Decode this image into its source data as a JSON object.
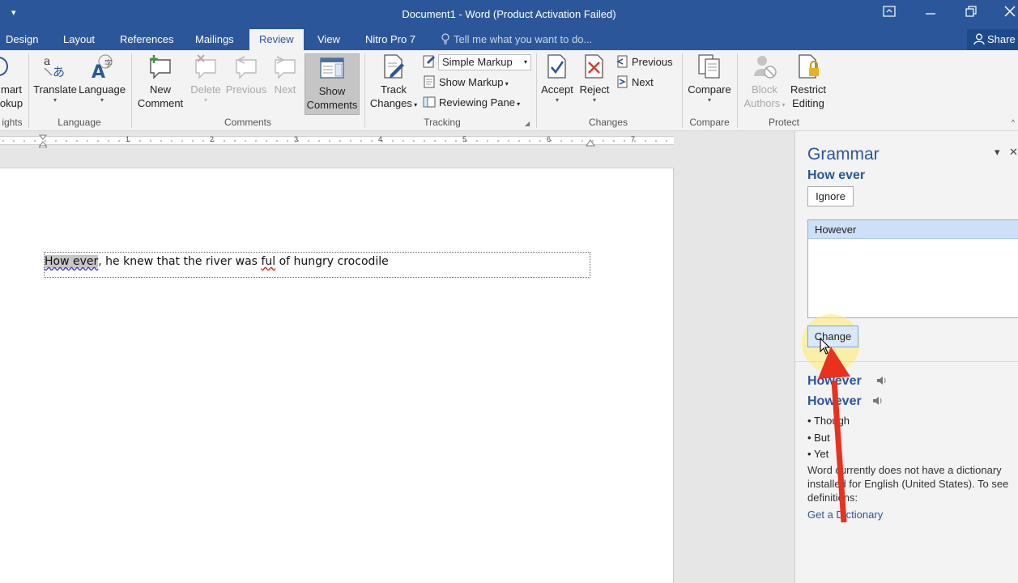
{
  "window": {
    "title": "Document1 - Word (Product Activation Failed)",
    "qat_icon": "customize-qat-icon"
  },
  "tabs": [
    "Design",
    "Layout",
    "References",
    "Mailings",
    "Review",
    "View",
    "Nitro Pro 7"
  ],
  "active_tab": "Review",
  "tell_me": "Tell me what you want to do...",
  "share": "Share",
  "ribbon": {
    "proofing_partial": {
      "label_top": "mart",
      "label_bottom": "okup",
      "group": "ights"
    },
    "language_group": {
      "translate": "Translate",
      "language": "Language",
      "label": "Language"
    },
    "comments_group": {
      "new_comment_l1": "New",
      "new_comment_l2": "Comment",
      "delete": "Delete",
      "previous": "Previous",
      "next": "Next",
      "show_comments_l1": "Show",
      "show_comments_l2": "Comments",
      "label": "Comments"
    },
    "tracking_group": {
      "track_changes_l1": "Track",
      "track_changes_l2": "Changes",
      "markup_selected": "Simple Markup",
      "show_markup": "Show Markup",
      "reviewing_pane": "Reviewing Pane",
      "label": "Tracking"
    },
    "changes_group": {
      "accept": "Accept",
      "reject": "Reject",
      "previous": "Previous",
      "next": "Next",
      "label": "Changes"
    },
    "compare_group": {
      "compare": "Compare",
      "label": "Compare"
    },
    "protect_group": {
      "block_authors_l1": "Block",
      "block_authors_l2": "Authors",
      "restrict_editing_l1": "Restrict",
      "restrict_editing_l2": "Editing",
      "label": "Protect"
    }
  },
  "ruler": [
    "1",
    "2",
    "3",
    "4",
    "5",
    "6",
    "7"
  ],
  "document": {
    "error_text": "How ever",
    "text_before_typo": ", he knew that the river was ",
    "typo": "ful",
    "text_after_typo": " of hungry crocodile"
  },
  "grammar_pane": {
    "title": "Grammar",
    "error_phrase": "How ever",
    "ignore_button": "Ignore",
    "suggestions": [
      "However"
    ],
    "change_button": "Change",
    "definitions": {
      "words": [
        "However",
        "However"
      ],
      "synonyms": [
        "Though",
        "But",
        "Yet"
      ],
      "note": "Word currently does not have a dictionary installed for English (United States). To see definitions:",
      "link": "Get a Dictionary"
    }
  },
  "colors": {
    "word_blue": "#2b579a",
    "annotation_arrow": "#e8321e",
    "cursor_highlight": "#ffec78"
  }
}
